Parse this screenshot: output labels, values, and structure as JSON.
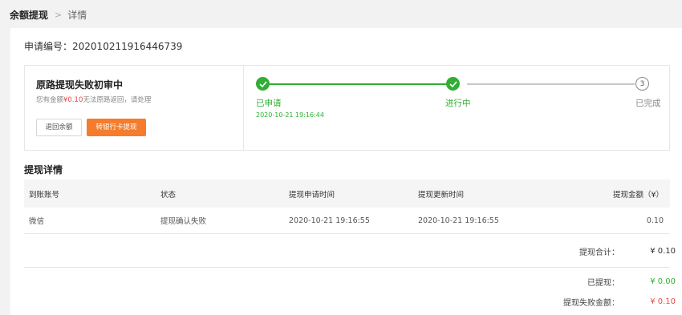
{
  "breadcrumb": {
    "parent": "余额提现",
    "separator": ">",
    "current": "详情"
  },
  "application": {
    "label": "申请编号：",
    "number": "202010211916446739"
  },
  "status": {
    "title": "原路提现失败初审中",
    "desc_prefix": "您有金额",
    "desc_amount": "¥0.10",
    "desc_suffix": "无法原路返回，请处理",
    "btn_back": "退回余额",
    "btn_bank": "转银行卡提现"
  },
  "steps": [
    {
      "label": "已申请",
      "state": "done",
      "time": "2020-10-21 19:16:44"
    },
    {
      "label": "进行中",
      "state": "done"
    },
    {
      "label": "已完成",
      "state": "pending",
      "number": "3"
    }
  ],
  "colors": {
    "success": "#31ae35",
    "danger": "#f04848",
    "primary": "#f47c2c"
  },
  "details": {
    "title": "提现详情",
    "headers": [
      "到账账号",
      "状态",
      "提现申请时间",
      "提现更新时间",
      "提现金额（¥）"
    ],
    "rows": [
      {
        "account": "微信",
        "status": "提现确认失败",
        "apply_time": "2020-10-21 19:16:55",
        "update_time": "2020-10-21 19:16:55",
        "amount": "0.10"
      }
    ]
  },
  "summary": {
    "total_label": "提现合计：",
    "total_value": "¥ 0.10",
    "withdrawn_label": "已提现：",
    "withdrawn_value": "¥ 0.00",
    "failed_label": "提现失败金额：",
    "failed_value": "¥ 0.10"
  }
}
